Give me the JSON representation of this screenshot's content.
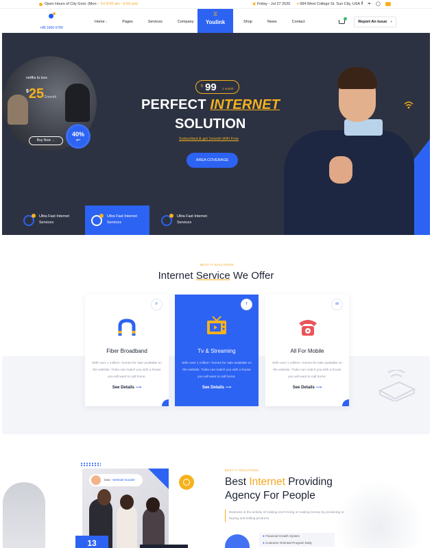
{
  "topbar": {
    "hours_text": "Open Hours of City Govt. (Mon - ",
    "hours_time": "Fri 8:00 am - 6:00 pm)",
    "date": "Friday - Jul 27 2020",
    "address": "684 West College St. Sun City, USA",
    "social": [
      "f",
      "t",
      "ig",
      "yt"
    ]
  },
  "nav": {
    "phone": "+88 1800 6789",
    "menu_left": [
      "Home",
      "Pages",
      "Services",
      "Company"
    ],
    "home_caret": "↓",
    "logo_name": "Youlink",
    "menu_right": [
      "Shop",
      "News",
      "Contact"
    ],
    "report_label": "Report An Issue",
    "report_arrow": "›"
  },
  "hero": {
    "netflix_label": "netflix to box",
    "offer_currency": "$",
    "offer_price": "25",
    "offer_period": "/1month",
    "buy_label": "Buy Now",
    "buy_arrow": "→",
    "discount_value": "40%",
    "discount_unit": "gps",
    "price_currency": "$",
    "price_value": "99",
    "price_period": "1 month",
    "title_line1_a": "PERFECT ",
    "title_line1_accent": "INTERNET",
    "title_line2": "SOLUTION",
    "subtitle": "Subscribed & get 1month WiFi Free",
    "cta_label": "AREA COVERAGE",
    "features": [
      {
        "line1": "Ultra Fast Internet",
        "line2": "Services"
      },
      {
        "line1": "Ultra Fast Internet",
        "line2": "Services"
      },
      {
        "line1": "Ultra Fast Internet",
        "line2": "Services"
      }
    ]
  },
  "services": {
    "tag": "BEST IT SOLUTIONS",
    "title_a": "Internet ",
    "title_accent": "Service",
    "title_b": " We Offer",
    "cards": [
      {
        "letter": "F",
        "title": "Fiber Broadband",
        "desc": "With over 1 million+ homes for sale available on the website. Trulia can match you with a house you will want to call home.",
        "link": "See Details",
        "arrow": "⟶"
      },
      {
        "letter": "T",
        "title": "Tv & Streaming",
        "desc": "With over 1 million+ homes for sale available on the website. Trulia can match you with a house you will want to call home.",
        "link": "See Details",
        "arrow": "⟶"
      },
      {
        "letter": "M",
        "title": "All For Mobile",
        "desc": "With over 1 million+ homes for sale available on the website. Trulia can match you with a house you will want to call home.",
        "link": "See Details",
        "arrow": "⟶"
      }
    ]
  },
  "agency": {
    "tag": "BEST IT SOLUTIONS",
    "title_a": "Best ",
    "title_accent": "Internet",
    "title_b": " Providing",
    "title_line2": "Agency For People",
    "desc": "Business is the activity of making one's living or making money by producing or buying and selling products",
    "ceo_name": "Ceo -",
    "ceo_role": "Website founder",
    "stat": "13",
    "checks": [
      "Financial Growth System",
      "Customer Oriented Program Daily"
    ],
    "bullet": "●"
  },
  "colors": {
    "accent_blue": "#2d63f2",
    "accent_gold": "#f5b21d",
    "hero_bg": "#2d3242"
  }
}
